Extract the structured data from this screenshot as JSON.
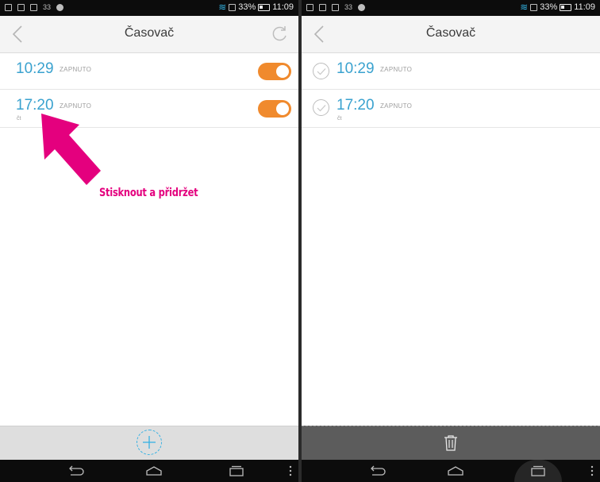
{
  "status_bar": {
    "notification_count": "33",
    "battery": "33%",
    "time": "11:09",
    "icons": [
      "sim-icon",
      "screenshot-icon",
      "mail-icon",
      "notification-count",
      "app-icon",
      "wifi-icon",
      "data-icon",
      "battery-icon"
    ]
  },
  "left_screen": {
    "title": "Časovač",
    "alarms": [
      {
        "time": "10:29",
        "state": "ZAPNUTO",
        "days": "",
        "enabled": true
      },
      {
        "time": "17:20",
        "state": "ZAPNUTO",
        "days": "čt",
        "enabled": true
      }
    ],
    "annotation": "Stisknout a přidržet",
    "bottom_action": "add-alarm-icon"
  },
  "right_screen": {
    "title": "Časovač",
    "alarms": [
      {
        "time": "10:29",
        "state": "ZAPNUTO",
        "days": "",
        "selected": false
      },
      {
        "time": "17:20",
        "state": "ZAPNUTO",
        "days": "čt",
        "selected": false
      }
    ],
    "bottom_action": "trash-icon"
  },
  "colors": {
    "accent_time": "#3aa2cf",
    "toggle_on": "#f08a2d",
    "annotation": "#e4007e",
    "statusbar": "#0c0c0c"
  }
}
